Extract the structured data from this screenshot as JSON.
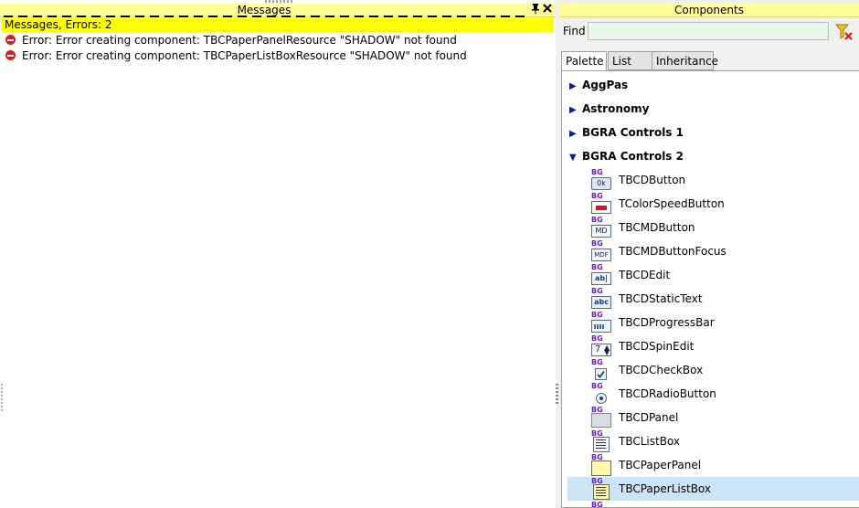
{
  "messages": {
    "title": "Messages",
    "summary": "Messages, Errors: 2",
    "rows": [
      "Error: Error creating component: TBCPaperPanelResource \"SHADOW\" not found",
      "Error: Error creating component: TBCPaperListBoxResource \"SHADOW\" not found"
    ],
    "pin_icon": "pin-icon",
    "close_icon": "close-icon"
  },
  "components": {
    "title": "Components",
    "find_label": "Find",
    "find_value": "",
    "filter_icon": "clear-filter-icon",
    "tabs": [
      "Palette",
      "List",
      "Inheritance"
    ],
    "active_tab": "Palette",
    "categories": [
      {
        "label": "AggPas",
        "expanded": false
      },
      {
        "label": "Astronomy",
        "expanded": false
      },
      {
        "label": "BGRA Controls 1",
        "expanded": false
      },
      {
        "label": "BGRA Controls 2",
        "expanded": true
      }
    ],
    "icon_tag": "BG",
    "items": [
      {
        "label": "TBCDButton",
        "icon": "ok-button-icon",
        "glyph": "0k"
      },
      {
        "label": "TColorSpeedButton",
        "icon": "color-button-icon",
        "glyph": ""
      },
      {
        "label": "TBCMDButton",
        "icon": "md-button-icon",
        "glyph": "MD"
      },
      {
        "label": "TBCMDButtonFocus",
        "icon": "mdf-button-icon",
        "glyph": "MDF"
      },
      {
        "label": "TBCDEdit",
        "icon": "edit-icon",
        "glyph": "ab|"
      },
      {
        "label": "TBCDStaticText",
        "icon": "static-text-icon",
        "glyph": "abc"
      },
      {
        "label": "TBCDProgressBar",
        "icon": "progress-bar-icon",
        "glyph": ""
      },
      {
        "label": "TBCDSpinEdit",
        "icon": "spin-edit-icon",
        "glyph": "7"
      },
      {
        "label": "TBCDCheckBox",
        "icon": "checkbox-icon",
        "glyph": ""
      },
      {
        "label": "TBCDRadioButton",
        "icon": "radio-button-icon",
        "glyph": ""
      },
      {
        "label": "TBCDPanel",
        "icon": "panel-icon",
        "glyph": ""
      },
      {
        "label": "TBCListBox",
        "icon": "listbox-icon",
        "glyph": ""
      },
      {
        "label": "TBCPaperPanel",
        "icon": "paper-panel-icon",
        "glyph": ""
      },
      {
        "label": "TBCPaperListBox",
        "icon": "paper-listbox-icon",
        "glyph": ""
      }
    ],
    "selected_item": "TBCPaperListBox",
    "colors": {
      "header": "#ffff99",
      "summary": "#ffff00",
      "selection": "#cce4f7",
      "error": "#d92020",
      "find_bg": "#eaf6ea"
    }
  }
}
